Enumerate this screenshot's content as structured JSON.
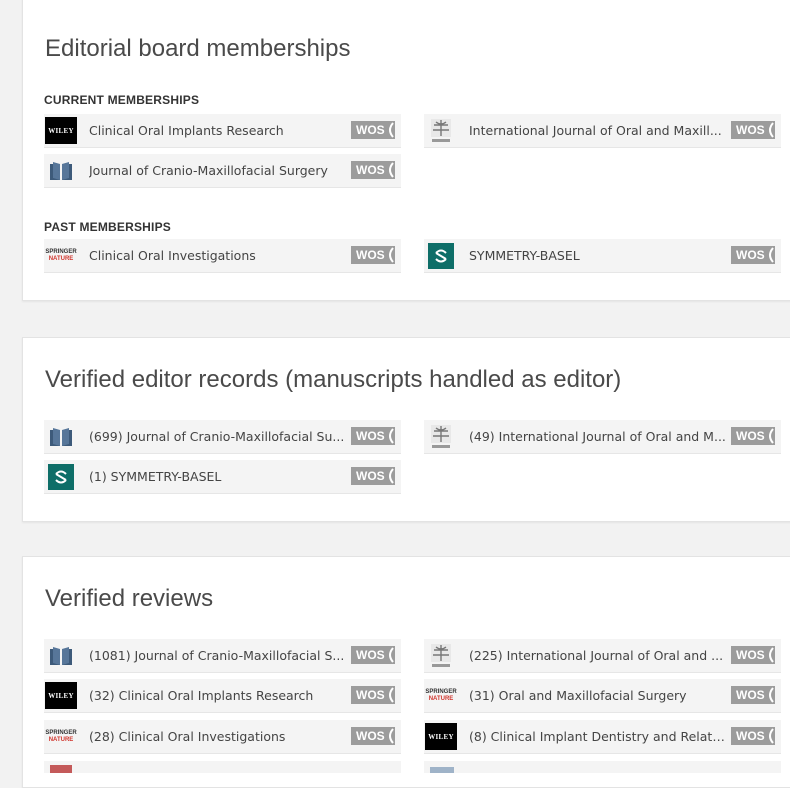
{
  "editorial": {
    "title": "Editorial board memberships",
    "current_heading": "CURRENT MEMBERSHIPS",
    "past_heading": "PAST MEMBERSHIPS",
    "current": [
      {
        "label": "Clinical Oral Implants Research",
        "publisher": "wiley",
        "badge": "WOS"
      },
      {
        "label": "International Journal of Oral and Maxill...",
        "publisher": "elsevier",
        "badge": "WOS"
      },
      {
        "label": "Journal of Cranio-Maxillofacial Surgery",
        "publisher": "book",
        "badge": "WOS"
      }
    ],
    "past": [
      {
        "label": "Clinical Oral Investigations",
        "publisher": "springer",
        "badge": "WOS"
      },
      {
        "label": "SYMMETRY-BASEL",
        "publisher": "symmetry",
        "badge": "WOS"
      }
    ]
  },
  "editor_records": {
    "title": "Verified editor records (manuscripts handled as editor)",
    "items": [
      {
        "label": "(699) Journal of Cranio-Maxillofacial Su...",
        "publisher": "book",
        "badge": "WOS"
      },
      {
        "label": "(49) International Journal of Oral and M...",
        "publisher": "elsevier",
        "badge": "WOS"
      },
      {
        "label": "(1) SYMMETRY-BASEL",
        "publisher": "symmetry",
        "badge": "WOS"
      }
    ]
  },
  "reviews": {
    "title": "Verified reviews",
    "items": [
      {
        "label": "(1081) Journal of Cranio-Maxillofacial S...",
        "publisher": "book",
        "badge": "WOS"
      },
      {
        "label": "(225) International Journal of Oral and ...",
        "publisher": "elsevier",
        "badge": "WOS"
      },
      {
        "label": "(32) Clinical Oral Implants Research",
        "publisher": "wiley",
        "badge": "WOS"
      },
      {
        "label": "(31) Oral and Maxillofacial Surgery",
        "publisher": "springer",
        "badge": "WOS"
      },
      {
        "label": "(28) Clinical Oral Investigations",
        "publisher": "springer",
        "badge": "WOS"
      },
      {
        "label": "(8) Clinical Implant Dentistry and Relate...",
        "publisher": "wiley",
        "badge": "WOS"
      }
    ]
  },
  "logos": {
    "wiley_text": "WILEY",
    "springer_top": "SPRINGER",
    "springer_bottom": "NATURE"
  },
  "colors": {
    "badge": "#9c9c9c",
    "symmetry": "#0e6e68",
    "book_icon": "#3d5a7a",
    "springer_red": "#d0342c"
  }
}
